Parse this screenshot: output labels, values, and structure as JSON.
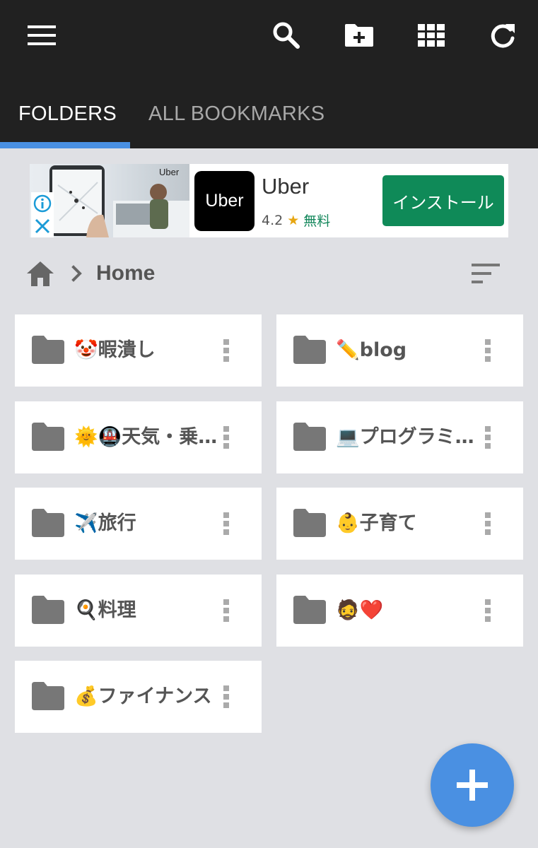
{
  "toolbar": {
    "menu_icon": "hamburger-menu-icon",
    "search_icon": "search-icon",
    "new_folder_icon": "new-folder-icon",
    "grid_view_icon": "grid-view-icon",
    "refresh_icon": "refresh-icon"
  },
  "tabs": [
    {
      "label": "FOLDERS",
      "active": true
    },
    {
      "label": "ALL BOOKMARKS",
      "active": false
    }
  ],
  "colors": {
    "appbar": "#212121",
    "accent": "#4a90e2",
    "background": "#dfe0e4",
    "install_button": "#0f8a58"
  },
  "ad": {
    "photo_brand": "Uber",
    "app_logo_text": "Uber",
    "app_name": "Uber",
    "rating": "4.2",
    "rating_star": "★",
    "price": "無料",
    "install_label": "インストール"
  },
  "breadcrumb": {
    "home_icon": "home-icon",
    "separator_icon": "chevron-right-icon",
    "title": "Home"
  },
  "sort_icon": "sort-icon",
  "folders": [
    {
      "name": "🤡暇潰し"
    },
    {
      "name": "✏️blog"
    },
    {
      "name": "🌞🚇天気・乗…"
    },
    {
      "name": "💻プログラミ…"
    },
    {
      "name": "✈️旅行"
    },
    {
      "name": "👶子育て"
    },
    {
      "name": "🍳料理"
    },
    {
      "name": "🧔❤️"
    },
    {
      "name": "💰ファイナンス"
    }
  ],
  "fab_icon": "add-icon"
}
